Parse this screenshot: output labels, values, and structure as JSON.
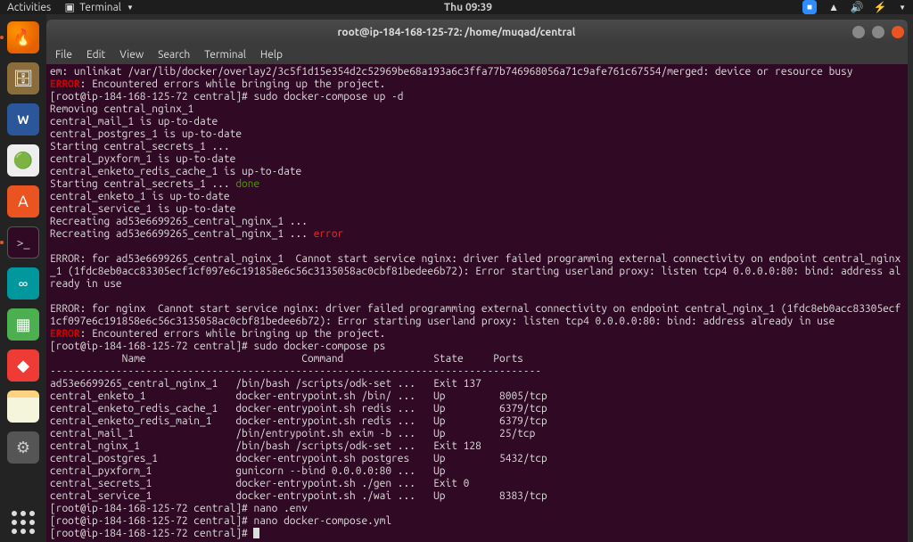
{
  "topbar": {
    "activities": "Activities",
    "app_menu": "Terminal",
    "clock": "Thu 09:39"
  },
  "dock": {
    "items": [
      {
        "name": "firefox",
        "glyph": "🦊"
      },
      {
        "name": "files",
        "glyph": "🗄"
      },
      {
        "name": "word",
        "glyph": "W"
      },
      {
        "name": "android-studio",
        "glyph": "▲"
      },
      {
        "name": "software",
        "glyph": "A"
      },
      {
        "name": "terminal",
        "glyph": ">_"
      },
      {
        "name": "arduino",
        "glyph": "∞"
      },
      {
        "name": "calc",
        "glyph": "▦"
      },
      {
        "name": "anydesk",
        "glyph": "◆"
      },
      {
        "name": "notes",
        "glyph": ""
      },
      {
        "name": "settings",
        "glyph": "⚙"
      }
    ]
  },
  "window": {
    "title": "root@ip-184-168-125-72: /home/muqad/central",
    "menus": [
      "File",
      "Edit",
      "View",
      "Search",
      "Terminal",
      "Help"
    ]
  },
  "term": {
    "l1": "em: unlinkat /var/lib/docker/overlay2/3c5f1d15e354d2c52969be68a193a6c3ffa77b746968056a71c9afe761c67554/merged: device or resource busy",
    "err1_tag": "ERROR",
    "err1_rest": ": Encountered errors while bringing up the project.",
    "prompt1": "[root@ip-184-168-125-72 central]# sudo docker-compose up -d",
    "l4": "Removing central_nginx_1",
    "l5": "central_mail_1 is up-to-date",
    "l6": "central_postgres_1 is up-to-date",
    "l7": "Starting central_secrets_1 ...",
    "l8": "central_pyxform_1 is up-to-date",
    "l9": "central_enketo_redis_cache_1 is up-to-date",
    "l10a": "Starting central_secrets_1 ... ",
    "l10b": "done",
    "l11": "central_enketo_1 is up-to-date",
    "l12": "central_service_1 is up-to-date",
    "l13": "Recreating ad53e6699265_central_nginx_1 ...",
    "l14a": "Recreating ad53e6699265_central_nginx_1 ... ",
    "l14b": "error",
    "blk1a": "ERROR: for ad53e6699265_central_nginx_1  Cannot start service nginx: driver failed programming external connectivity on endpoint central_nginx",
    "blk1b": "_1 (1fdc8eb0acc83305ecf1cf097e6c191858e6c56c3135058ac0cbf81bedee6b72): Error starting userland proxy: listen tcp4 0.0.0.0:80: bind: address al",
    "blk1c": "ready in use",
    "blk2a": "ERROR: for nginx  Cannot start service nginx: driver failed programming external connectivity on endpoint central_nginx_1 (1fdc8eb0acc83305ecf",
    "blk2b": "1cf097e6c191858e6c56c3135058ac0cbf81bedee6b72): Error starting userland proxy: listen tcp4 0.0.0.0:80: bind: address already in use",
    "err2_tag": "ERROR",
    "err2_rest": ": Encountered errors while bringing up the project.",
    "prompt2": "[root@ip-184-168-125-72 central]# sudo docker-compose ps",
    "hdr": "            Name                          Command               State     Ports  ",
    "sep": "----------------------------------------------------------------------------------",
    "rows": [
      "ad53e6699265_central_nginx_1   /bin/bash /scripts/odk-set ...   Exit 137           ",
      "central_enketo_1               docker-entrypoint.sh /bin/ ...   Up         8005/tcp",
      "central_enketo_redis_cache_1   docker-entrypoint.sh redis ...   Up         6379/tcp",
      "central_enketo_redis_main_1    docker-entrypoint.sh redis ...   Up         6379/tcp",
      "central_mail_1                 /bin/entrypoint.sh exim -b ...   Up         25/tcp  ",
      "central_nginx_1                /bin/bash /scripts/odk-set ...   Exit 128           ",
      "central_postgres_1             docker-entrypoint.sh postgres    Up         5432/tcp",
      "central_pyxform_1              gunicorn --bind 0.0.0.0:80 ...   Up                 ",
      "central_secrets_1              docker-entrypoint.sh ./gen ...   Exit 0             ",
      "central_service_1              docker-entrypoint.sh ./wai ...   Up         8383/tcp"
    ],
    "prompt3": "[root@ip-184-168-125-72 central]# nano .env",
    "prompt4": "[root@ip-184-168-125-72 central]# nano docker-compose.yml",
    "prompt5": "[root@ip-184-168-125-72 central]# "
  }
}
